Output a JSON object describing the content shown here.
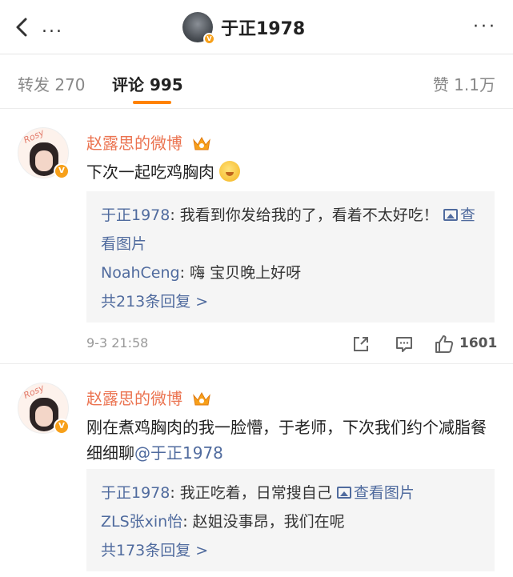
{
  "header": {
    "title": "于正1978",
    "more_left": "...",
    "more_right": "···"
  },
  "tabs": {
    "repost": "转发 270",
    "comment": "评论 995",
    "like": "赞 1.1万"
  },
  "comments": [
    {
      "user": "赵露思的微博",
      "text": "下次一起吃鸡胸肉",
      "replies": [
        {
          "name": "于正1978",
          "text": ": 我看到你发给我的了，看着不太好吃！",
          "link": "查看图片"
        },
        {
          "name": "NoahCeng",
          "text": ": 嗨  宝贝晚上好呀"
        }
      ],
      "total": "共213条回复 >",
      "time": "9-3 21:58",
      "likes": "1601"
    },
    {
      "user": "赵露思的微博",
      "text": "刚在煮鸡胸肉的我一脸懵，于老师，下次我们约个减脂餐细细聊",
      "mention": "@于正1978",
      "replies": [
        {
          "name": "于正1978",
          "text": ": 我正吃着，日常搜自己",
          "link": "查看图片"
        },
        {
          "name": "ZLS张xin怡",
          "text": ": 赵姐没事昂，我们在呢"
        }
      ],
      "total": "共173条回复 >"
    }
  ],
  "colors": {
    "accent": "#ff8200",
    "username": "#eb7350",
    "link": "#506b9e",
    "badge": "#f7a01a"
  },
  "icons": [
    "back-chevron-icon",
    "vip-crown-icon",
    "verified-v-icon",
    "emoji-icon",
    "image-icon",
    "share-icon",
    "reply-icon",
    "thumbs-up-icon"
  ]
}
